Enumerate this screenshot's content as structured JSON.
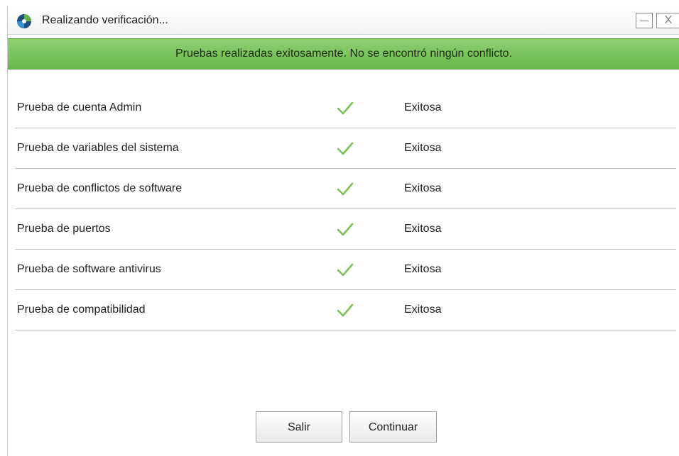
{
  "window": {
    "title": "Realizando verificación...",
    "close_glyph": "X"
  },
  "banner": {
    "message": "Pruebas realizadas exitosamente. No se encontró ningún conflicto.",
    "color": "#6fbe51"
  },
  "tests": [
    {
      "name": "Prueba de cuenta Admin",
      "status_icon": "check-icon",
      "result": "Exitosa"
    },
    {
      "name": "Prueba de variables del sistema",
      "status_icon": "check-icon",
      "result": "Exitosa"
    },
    {
      "name": "Prueba de conflictos de software",
      "status_icon": "check-icon",
      "result": "Exitosa"
    },
    {
      "name": "Prueba de puertos",
      "status_icon": "check-icon",
      "result": "Exitosa"
    },
    {
      "name": "Prueba de software antivirus",
      "status_icon": "check-icon",
      "result": "Exitosa"
    },
    {
      "name": "Prueba de compatibilidad",
      "status_icon": "check-icon",
      "result": "Exitosa"
    }
  ],
  "buttons": {
    "exit_label": "Salir",
    "continue_label": "Continuar"
  },
  "colors": {
    "check": "#7cc05a",
    "banner": "#6fbe51"
  }
}
